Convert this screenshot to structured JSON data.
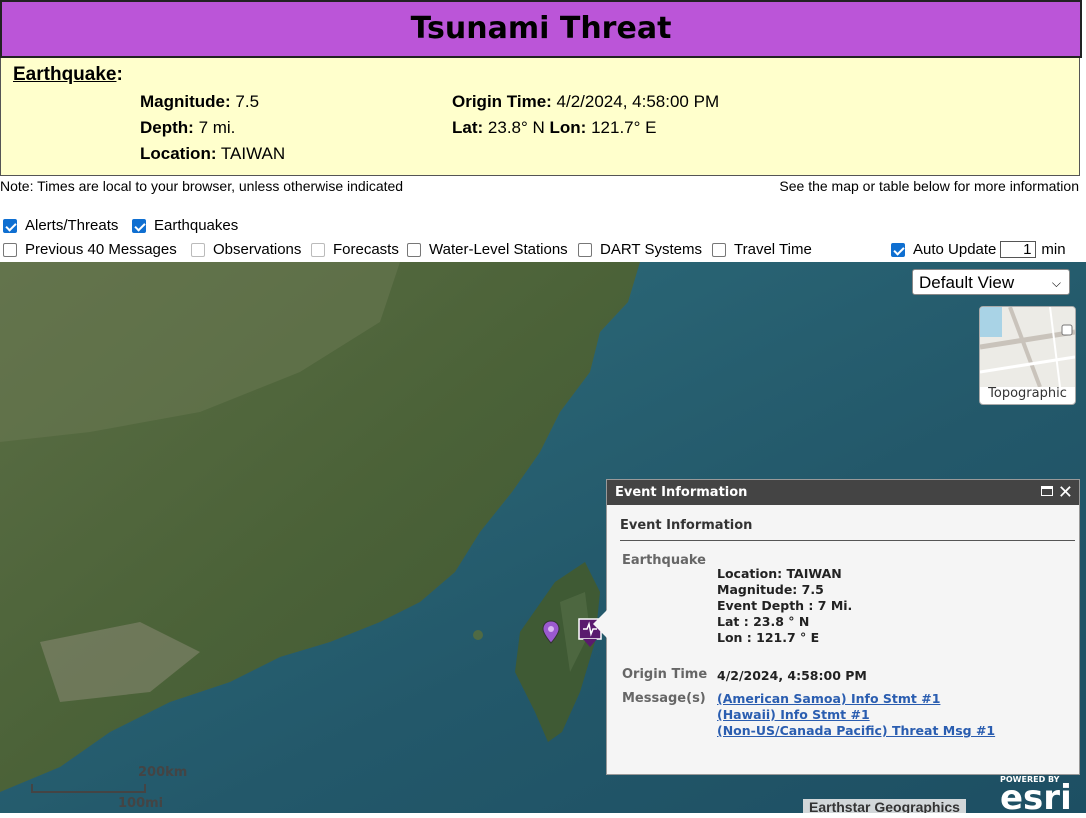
{
  "header": {
    "title": "Tsunami Threat"
  },
  "earthquake": {
    "heading": "Earthquake",
    "magnitude_label": "Magnitude:",
    "magnitude": "7.5",
    "depth_label": "Depth:",
    "depth": "7 mi.",
    "location_label": "Location:",
    "location": "TAIWAN",
    "origin_label": "Origin Time:",
    "origin": "4/2/2024, 4:58:00 PM",
    "lat_label": "Lat:",
    "lat": "23.8° N",
    "lon_label": "Lon:",
    "lon": "121.7° E"
  },
  "notes": {
    "left": "Note: Times are local to your browser, unless otherwise indicated",
    "right": "See the map or table below for more information"
  },
  "options": {
    "alerts": "Alerts/Threats",
    "earthquakes": "Earthquakes",
    "previous": "Previous 40 Messages",
    "observations": "Observations",
    "forecasts": "Forecasts",
    "water_level": "Water-Level Stations",
    "dart": "DART Systems",
    "travel": "Travel Time",
    "auto_update": "Auto Update",
    "auto_update_value": "1",
    "min": "min"
  },
  "map": {
    "view_select": "Default View",
    "basemap_label": "Topographic",
    "scale_km": "200km",
    "scale_mi": "100mi",
    "attribution": "Earthstar Geographics",
    "esri_powered": "POWERED BY",
    "esri_logo": "esri"
  },
  "popup": {
    "title": "Event Information",
    "subtitle": "Event Information",
    "earthquake_key": "Earthquake",
    "location": "Location: TAIWAN",
    "magnitude": "Magnitude: 7.5",
    "depth": "Event Depth : 7 Mi.",
    "lat": "Lat : 23.8 ° N",
    "lon": "Lon : 121.7 ° E",
    "origin_key": "Origin Time",
    "origin_value": "4/2/2024, 4:58:00 PM",
    "messages_key": "Message(s)",
    "messages": [
      "(American Samoa) Info Stmt #1",
      "(Hawaii) Info Stmt #1",
      "(Non-US/Canada Pacific) Threat Msg #1"
    ]
  },
  "colors": {
    "title_bg": "#bb55d8",
    "panel_bg": "#ffffcc",
    "checkbox": "#0f6fd1",
    "marker": "#5a1a6e"
  }
}
